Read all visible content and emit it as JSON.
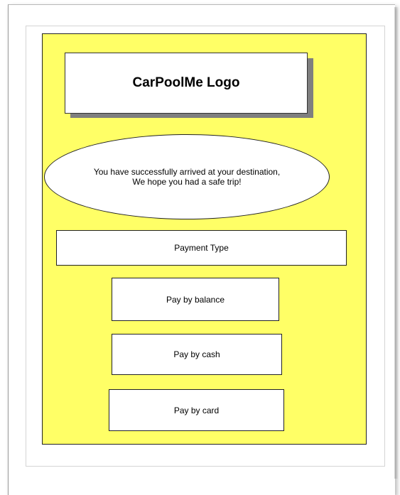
{
  "logo": {
    "text": "CarPoolMe Logo"
  },
  "message": {
    "line1": "You have successfully arrived at your destination,",
    "line2": "We hope you had a safe trip!"
  },
  "payment": {
    "header": "Payment Type",
    "options": [
      "Pay by balance",
      "Pay by cash",
      "Pay by card"
    ]
  },
  "colors": {
    "panel_background": "#ffff66",
    "box_background": "#ffffff",
    "border": "#222222",
    "logo_shadow": "#7f7f7f"
  }
}
